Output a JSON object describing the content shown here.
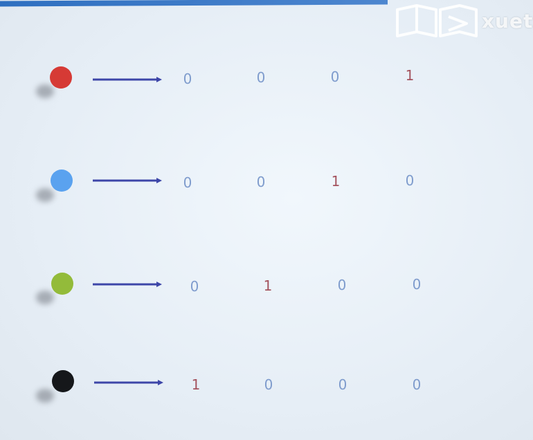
{
  "logo": {
    "text": "xuet"
  },
  "rows": [
    {
      "dot_color": "#d63a35",
      "values": [
        "0",
        "0",
        "0",
        "1"
      ]
    },
    {
      "dot_color": "#5aa2ef",
      "values": [
        "0",
        "0",
        "1",
        "0"
      ]
    },
    {
      "dot_color": "#93bb3a",
      "values": [
        "0",
        "1",
        "0",
        "0"
      ]
    },
    {
      "dot_color": "#15171a",
      "values": [
        "1",
        "0",
        "0",
        "0"
      ]
    }
  ],
  "colors": {
    "arrow": "#3d46a8",
    "zero": "#7f9ccd",
    "one": "#a4535e"
  }
}
